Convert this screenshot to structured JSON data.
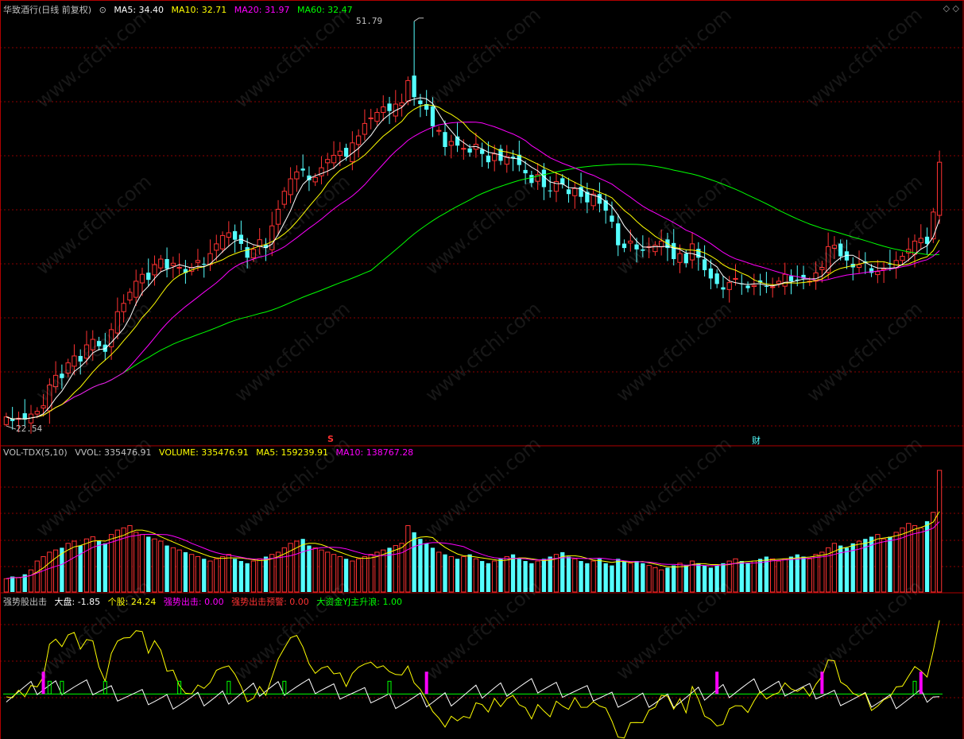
{
  "main_header": {
    "stock": "华致酒行(日线 前复权)",
    "ma5": "MA5: 34.40",
    "ma10": "MA10: 32.71",
    "ma20": "MA20: 31.97",
    "ma60": "MA60: 32.47"
  },
  "price_annotations": {
    "high": "51.79",
    "low": "22.54",
    "marker_s": "S",
    "marker_cai": "财"
  },
  "vol_header": {
    "name": "VOL-TDX(5,10)",
    "vvol": "VVOL: 335476.91",
    "volume": "VOLUME: 335476.91",
    "ma5": "MA5: 159239.91",
    "ma10": "MA10: 138767.28"
  },
  "ind_header": {
    "name": "强势股出击",
    "dapan": "大盘: -1.85",
    "gegu": "个股: 24.24",
    "qsj": "强势出击: 0.00",
    "qsyj": "强势出击预警: 0.00",
    "djz": "大资金YJ主升浪: 1.00"
  },
  "watermark": "www.cfchi.com",
  "colors": {
    "up": "#ff3232",
    "down": "#54ffff",
    "ma5": "#ffffff",
    "ma10": "#ffff00",
    "ma20": "#ff00ff",
    "ma60": "#00ff00",
    "grid": "#8b0000"
  },
  "chart_data": {
    "type": "candlestick",
    "price_markers": {
      "high": 51.79,
      "low": 22.54
    },
    "closes": [
      23.2,
      22.9,
      23.1,
      23.0,
      23.4,
      23.6,
      24.0,
      25.5,
      26.2,
      26.0,
      27.1,
      27.6,
      27.2,
      28.4,
      28.8,
      28.3,
      27.9,
      29.5,
      30.8,
      31.4,
      32.2,
      33.0,
      33.5,
      33.1,
      34.2,
      34.6,
      33.9,
      34.3,
      34.0,
      33.6,
      34.0,
      34.5,
      34.2,
      35.0,
      35.7,
      36.3,
      36.5,
      36.0,
      35.7,
      34.7,
      35.3,
      36.0,
      35.4,
      37.0,
      38.2,
      39.5,
      40.4,
      40.9,
      41.0,
      40.3,
      40.5,
      41.2,
      41.8,
      42.1,
      42.4,
      42.0,
      43.0,
      43.5,
      44.4,
      44.8,
      45.2,
      45.6,
      45.3,
      45.8,
      45.9,
      47.5,
      46.3,
      45.8,
      45.4,
      44.2,
      43.9,
      42.7,
      43.1,
      42.8,
      42.6,
      42.3,
      42.9,
      42.2,
      41.6,
      42.2,
      41.7,
      42.0,
      41.9,
      41.4,
      40.8,
      40.1,
      40.7,
      39.8,
      39.5,
      40.2,
      40.0,
      39.3,
      39.7,
      39.1,
      38.7,
      39.3,
      38.6,
      38.1,
      37.3,
      35.6,
      35.4,
      35.9,
      35.3,
      35.2,
      35.5,
      35.6,
      35.9,
      35.4,
      34.6,
      35.0,
      34.3,
      35.7,
      34.7,
      33.8,
      33.2,
      32.8,
      32.4,
      32.9,
      33.2,
      32.8,
      32.5,
      32.7,
      32.9,
      32.6,
      32.6,
      33.0,
      33.5,
      33.0,
      33.1,
      33.2,
      33.0,
      33.6,
      34.0,
      35.5,
      35.6,
      34.8,
      34.5,
      34.0,
      34.2,
      34.3,
      33.6,
      33.7,
      33.9,
      34.2,
      34.5,
      34.8,
      35.3,
      35.9,
      36.1,
      35.7,
      38.0,
      41.6
    ],
    "volume": [
      12,
      14,
      13,
      16,
      20,
      28,
      32,
      36,
      38,
      40,
      44,
      46,
      42,
      48,
      50,
      46,
      44,
      52,
      56,
      58,
      60,
      54,
      52,
      50,
      48,
      46,
      42,
      40,
      38,
      36,
      34,
      32,
      30,
      28,
      30,
      32,
      34,
      30,
      28,
      26,
      28,
      30,
      32,
      34,
      36,
      40,
      44,
      46,
      48,
      42,
      40,
      38,
      36,
      34,
      32,
      30,
      28,
      30,
      32,
      34,
      36,
      38,
      40,
      42,
      44,
      60,
      54,
      48,
      44,
      40,
      36,
      34,
      32,
      30,
      32,
      34,
      30,
      28,
      26,
      28,
      30,
      32,
      34,
      30,
      28,
      26,
      28,
      30,
      32,
      34,
      36,
      32,
      30,
      28,
      26,
      28,
      30,
      26,
      24,
      30,
      28,
      26,
      28,
      26,
      24,
      22,
      20,
      22,
      24,
      26,
      24,
      28,
      26,
      24,
      22,
      24,
      26,
      28,
      30,
      28,
      26,
      28,
      30,
      32,
      30,
      28,
      30,
      32,
      34,
      32,
      30,
      34,
      36,
      40,
      44,
      42,
      40,
      44,
      46,
      48,
      50,
      52,
      48,
      50,
      54,
      58,
      62,
      60,
      58,
      64,
      72,
      110
    ],
    "volume_range": [
      0,
      120
    ],
    "indicator_range": [
      -30,
      60
    ]
  }
}
